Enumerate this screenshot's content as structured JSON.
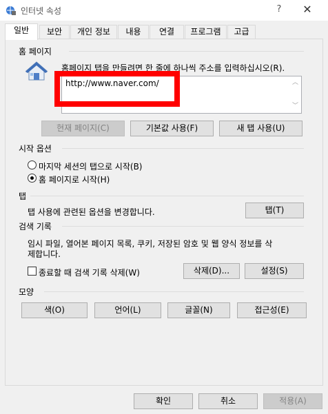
{
  "window": {
    "title": "인터넷 속성",
    "help": "?",
    "close": "✕"
  },
  "tabs": [
    {
      "label": "일반",
      "active": true
    },
    {
      "label": "보안",
      "active": false
    },
    {
      "label": "개인 정보",
      "active": false
    },
    {
      "label": "내용",
      "active": false
    },
    {
      "label": "연결",
      "active": false
    },
    {
      "label": "프로그램",
      "active": false
    },
    {
      "label": "고급",
      "active": false
    }
  ],
  "home": {
    "group_label": "홈 페이지",
    "instruction": "홈페이지 탭을 만들려면 한 줄에 하나씩 주소를 입력하십시오(R).",
    "url": "http://www.naver.com/",
    "btn_current": "현재 페이지(C)",
    "btn_default": "기본값 사용(F)",
    "btn_newtab": "새 탭 사용(U)"
  },
  "startup": {
    "group_label": "시작 옵션",
    "option_last": "마지막 세션의 탭으로 시작(B)",
    "option_home": "홈 페이지로 시작(H)",
    "selected": "home"
  },
  "tabs_section": {
    "group_label": "탭",
    "description": "탭 사용에 관련된 옵션을 변경합니다.",
    "btn": "탭(T)"
  },
  "history": {
    "group_label": "검색 기록",
    "description_line1": "임시 파일, 열어본 페이지 목록, 쿠키, 저장된 암호 및 웹 양식 정보를 삭",
    "description_line2": "제합니다.",
    "checkbox_label": "종료할 때 검색 기록 삭제(W)",
    "checked": false,
    "btn_delete": "삭제(D)...",
    "btn_settings": "설정(S)"
  },
  "appearance": {
    "group_label": "모양",
    "btn_color": "색(O)",
    "btn_language": "언어(L)",
    "btn_font": "글꼴(N)",
    "btn_accessibility": "접근성(E)"
  },
  "footer": {
    "ok": "확인",
    "cancel": "취소",
    "apply": "적용(A)"
  },
  "colors": {
    "highlight": "#ff0000"
  }
}
